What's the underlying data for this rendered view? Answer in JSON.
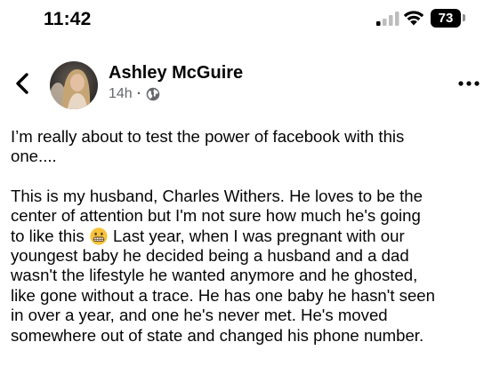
{
  "status_bar": {
    "time": "11:42",
    "battery_level": "73"
  },
  "post": {
    "author": "Ashley McGuire",
    "timestamp": "14h",
    "separator": "·",
    "audience_icon": "globe-icon",
    "paragraph_1": "I’m really about to test the power of facebook with this\none....",
    "paragraph_2_before_emoji": "This is my husband, Charles Withers. He loves to be the\ncenter of attention but I'm not sure how much he's going\nto like this",
    "emoji_icon": "grimacing-face-emoji",
    "paragraph_2_after_emoji": " Last year, when I was pregnant with our\nyoungest baby he decided being a husband and a dad\nwasn't the lifestyle he wanted anymore and he ghosted,\nlike gone without a trace. He has one baby he hasn't seen\nin over a year, and one he's never met. He's moved\nsomewhere out of state and changed his phone number."
  },
  "colors": {
    "text": "#050505",
    "secondary_text": "#65676b",
    "emoji_yellow": "#f5c33b"
  }
}
